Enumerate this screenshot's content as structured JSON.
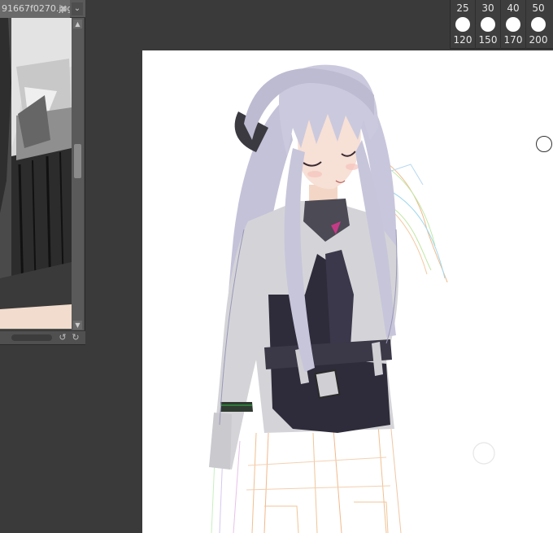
{
  "reference_window": {
    "tab_title": "91667f0270.jpg",
    "close_glyph": "✖",
    "menu_glyph": "⌄",
    "scroll_up": "▲",
    "scroll_down": "▼",
    "rotate_left": "↺",
    "rotate_right": "↻"
  },
  "brush_sizes": {
    "top_row": [
      "25",
      "30",
      "40",
      "50"
    ],
    "bottom_row": [
      "120",
      "150",
      "170",
      "200"
    ]
  },
  "colors": {
    "background": "#3a3a3a",
    "canvas": "#ffffff",
    "hair": "#c9c8dc",
    "jacket": "#d2d2d6",
    "jacket_dark": "#2d2b38"
  }
}
